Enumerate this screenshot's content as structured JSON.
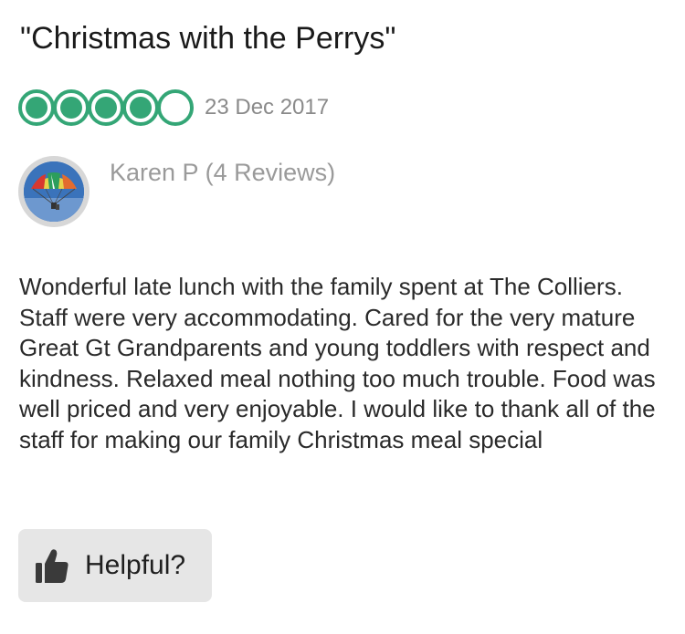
{
  "review": {
    "title": "\"Christmas with the Perrys\"",
    "rating": {
      "value": 4,
      "max": 5
    },
    "date": "23 Dec 2017",
    "reviewer": "Karen P (4 Reviews)",
    "body": "Wonderful late lunch with the family spent at The Colliers. Staff were very accommodating. Cared for the very mature Great Gt Grandparents and young toddlers with respect and kindness. Relaxed meal nothing too much trouble. Food was well priced and very enjoyable. I would like to thank all of the staff for making our family Christmas meal special",
    "helpful_label": "Helpful?"
  },
  "icons": {
    "rating_bubble": "rating-bubble-icon",
    "thumbs_up": "thumbs-up-icon"
  },
  "colors": {
    "rating_green": "#34a676",
    "button_bg": "#e6e6e6",
    "muted_text": "#8a8a8a"
  }
}
